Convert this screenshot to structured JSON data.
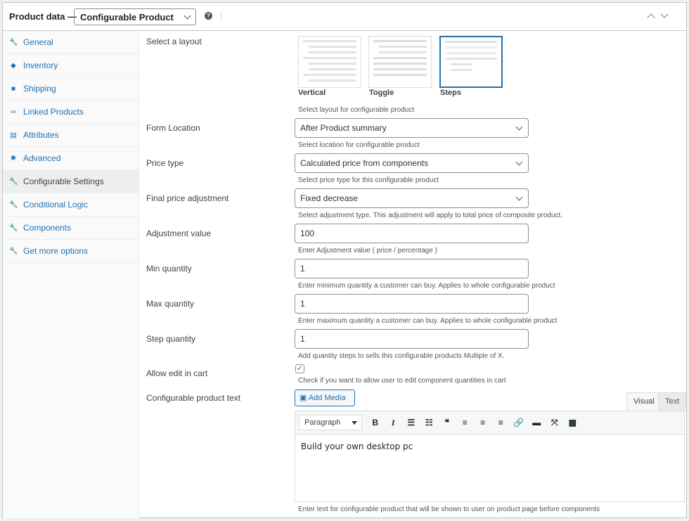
{
  "header": {
    "title": "Product data —",
    "product_type": "Configurable Product",
    "help": "?"
  },
  "sidebar": {
    "items": [
      {
        "label": "General",
        "icon": "wrench-icon",
        "glyph": "🔧"
      },
      {
        "label": "Inventory",
        "icon": "tag-icon",
        "glyph": "◆"
      },
      {
        "label": "Shipping",
        "icon": "truck-icon",
        "glyph": "■"
      },
      {
        "label": "Linked Products",
        "icon": "link-icon",
        "glyph": "∞"
      },
      {
        "label": "Attributes",
        "icon": "list-icon",
        "glyph": "▤"
      },
      {
        "label": "Advanced",
        "icon": "gear-icon",
        "glyph": "✱"
      },
      {
        "label": "Configurable Settings",
        "icon": "wrench-icon",
        "glyph": "🔧"
      },
      {
        "label": "Conditional Logic",
        "icon": "wrench-icon",
        "glyph": "🔧"
      },
      {
        "label": "Components",
        "icon": "wrench-icon",
        "glyph": "🔧"
      },
      {
        "label": "Get more options",
        "icon": "wrench-icon",
        "glyph": "🔧"
      }
    ]
  },
  "layout": {
    "label": "Select a layout",
    "options": [
      "Vertical",
      "Toggle",
      "Steps"
    ],
    "selected": "Steps",
    "desc": "Select layout for configurable product"
  },
  "form_location": {
    "label": "Form Location",
    "value": "After Product summary",
    "desc": "Select location for configurable product"
  },
  "price_type": {
    "label": "Price type",
    "value": "Calculated price from components",
    "desc": "Select price type for this configurable product"
  },
  "final_adj": {
    "label": "Final price adjustment",
    "value": "Fixed decrease",
    "desc": "Select adjustment type. This adjustment will apply to total price of composite product."
  },
  "adj_value": {
    "label": "Adjustment value",
    "value": "100",
    "desc": "Enter Adjustment value ( price / percentage )"
  },
  "min_qty": {
    "label": "Min quantity",
    "value": "1",
    "desc": "Enter minimum quantity a customer can buy. Applies to whole configurable product"
  },
  "max_qty": {
    "label": "Max quantity",
    "value": "1",
    "desc": "Enter maximum quantity a customer can buy. Applies to whole configurable product"
  },
  "step_qty": {
    "label": "Step quantity",
    "value": "1",
    "desc": "Add quantity steps to sells this configurable products Multiple of X."
  },
  "allow_edit": {
    "label": "Allow edit in cart",
    "checked": true,
    "check": "✓",
    "desc": "Check if you want to allow user to edit component quantities in cart"
  },
  "cp_text": {
    "label": "Configurable product text",
    "add_media": "Add Media",
    "tab_visual": "Visual",
    "tab_text": "Text",
    "format": "Paragraph",
    "content": "Build your own desktop pc",
    "desc": "Enter text for configurable product that will be shown to user on product page before components",
    "toolbar": [
      {
        "name": "bold",
        "g": "B"
      },
      {
        "name": "italic",
        "g": "I"
      },
      {
        "name": "bullet-list",
        "g": "☰"
      },
      {
        "name": "numbered-list",
        "g": "☷"
      },
      {
        "name": "blockquote",
        "g": "❝"
      },
      {
        "name": "align-left",
        "g": "≡"
      },
      {
        "name": "align-center",
        "g": "≡"
      },
      {
        "name": "align-right",
        "g": "≡"
      },
      {
        "name": "link",
        "g": "🔗"
      },
      {
        "name": "read-more",
        "g": "▬"
      },
      {
        "name": "fullscreen",
        "g": "⤧"
      },
      {
        "name": "toolbar-toggle",
        "g": "▦"
      }
    ]
  }
}
